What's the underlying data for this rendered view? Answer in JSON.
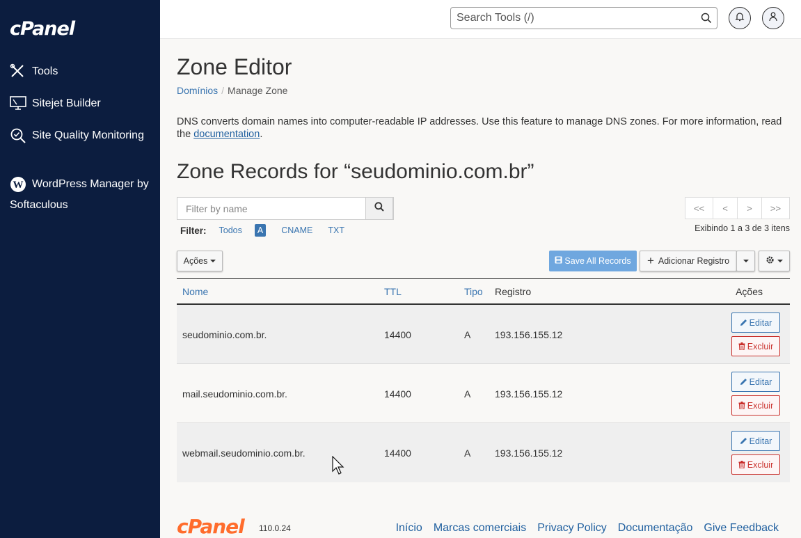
{
  "sidebar": {
    "logo": "cPanel",
    "items": [
      {
        "label": "Tools",
        "icon": "tools-icon"
      },
      {
        "label": "Sitejet Builder",
        "icon": "monitor-icon"
      },
      {
        "label": "Site Quality Monitoring",
        "icon": "magnifier-check-icon"
      },
      {
        "label": "WordPress Manager by Softaculous",
        "icon": "wordpress-icon"
      }
    ]
  },
  "header": {
    "search_placeholder": "Search Tools (/)"
  },
  "page": {
    "title": "Zone Editor",
    "breadcrumb": [
      "Domínios",
      "Manage Zone"
    ],
    "description": "DNS converts domain names into computer-readable IP addresses. Use this feature to manage DNS zones. For more information, read the ",
    "description_link": "documentation",
    "description_end": ".",
    "zone_title": "Zone Records for “seudominio.com.br”"
  },
  "filter": {
    "placeholder": "Filter by name",
    "label": "Filter:",
    "options": [
      "Todos",
      "A",
      "CNAME",
      "TXT"
    ],
    "active": "A"
  },
  "pager": {
    "buttons": [
      "<<",
      "<",
      ">",
      ">>"
    ],
    "showing": "Exibindo 1 a 3 de 3 itens"
  },
  "toolbar": {
    "acoes": "Ações",
    "save_all": "Save All Records",
    "add_record": "Adicionar Registro"
  },
  "table": {
    "headers": {
      "name": "Nome",
      "ttl": "TTL",
      "type": "Tipo",
      "record": "Registro",
      "actions": "Ações"
    },
    "rows": [
      {
        "name": "seudominio.com.br.",
        "ttl": "14400",
        "type": "A",
        "record": "193.156.155.12"
      },
      {
        "name": "mail.seudominio.com.br.",
        "ttl": "14400",
        "type": "A",
        "record": "193.156.155.12"
      },
      {
        "name": "webmail.seudominio.com.br.",
        "ttl": "14400",
        "type": "A",
        "record": "193.156.155.12"
      }
    ],
    "edit_label": "Editar",
    "delete_label": "Excluir"
  },
  "footer": {
    "logo": "cPanel",
    "version": "110.0.24",
    "links": [
      "Início",
      "Marcas comerciais",
      "Privacy Policy",
      "Documentação",
      "Give Feedback"
    ]
  },
  "colors": {
    "sidebar_bg": "#0c1d3f",
    "link": "#3a75b0",
    "save_button": "#6fa7df",
    "delete": "#c9302c",
    "footer_logo": "#ff6c2c"
  }
}
